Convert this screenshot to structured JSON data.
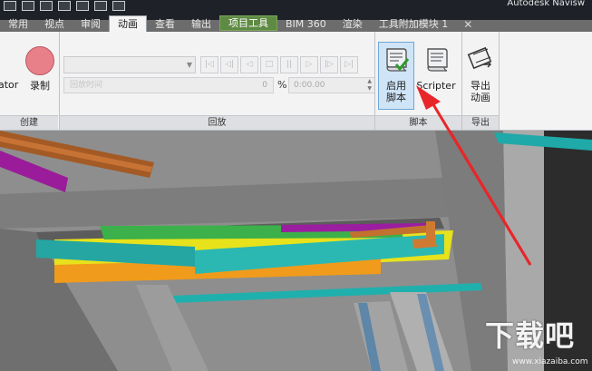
{
  "app": {
    "title": "Autodesk Navisw"
  },
  "tabs": [
    {
      "label": "常用",
      "state": "normal"
    },
    {
      "label": "视点",
      "state": "normal"
    },
    {
      "label": "审阅",
      "state": "normal"
    },
    {
      "label": "动画",
      "state": "active"
    },
    {
      "label": "查看",
      "state": "normal"
    },
    {
      "label": "输出",
      "state": "normal"
    },
    {
      "label": "项目工具",
      "state": "contextual"
    },
    {
      "label": "BIM 360",
      "state": "normal"
    },
    {
      "label": "渲染",
      "state": "normal"
    },
    {
      "label": "工具附加模块 1",
      "state": "normal"
    }
  ],
  "tab_close": "✕",
  "ribbon": {
    "create": {
      "title": "创建",
      "animator_label": "ator",
      "record_label": "录制"
    },
    "playback": {
      "title": "回放",
      "animation_select": "",
      "position_placeholder": "回放时间",
      "position_value": "0",
      "percent": "%",
      "time_value": "0:00.00",
      "controls": [
        {
          "name": "to-start",
          "glyph": "|◁"
        },
        {
          "name": "step-back",
          "glyph": "◁|"
        },
        {
          "name": "play-reverse",
          "glyph": "◁"
        },
        {
          "name": "stop",
          "glyph": "□"
        },
        {
          "name": "pause",
          "glyph": "||"
        },
        {
          "name": "play",
          "glyph": "▷"
        },
        {
          "name": "step-forward",
          "glyph": "|▷"
        },
        {
          "name": "to-end",
          "glyph": "▷|"
        }
      ]
    },
    "script": {
      "title": "脚本",
      "enable_label_line1": "启用",
      "enable_label_line2": "脚本",
      "scripter_label": "Scripter"
    },
    "export": {
      "title": "导出",
      "export_label_line1": "导出",
      "export_label_line2": "动画"
    }
  },
  "watermark": {
    "text": "下载吧",
    "url": "www.xiazaiba.com"
  },
  "colors": {
    "annotation_arrow": "#e8262a",
    "ribbon_highlight": "#cfe4f7",
    "contextual_tab": "#5f8a43"
  }
}
